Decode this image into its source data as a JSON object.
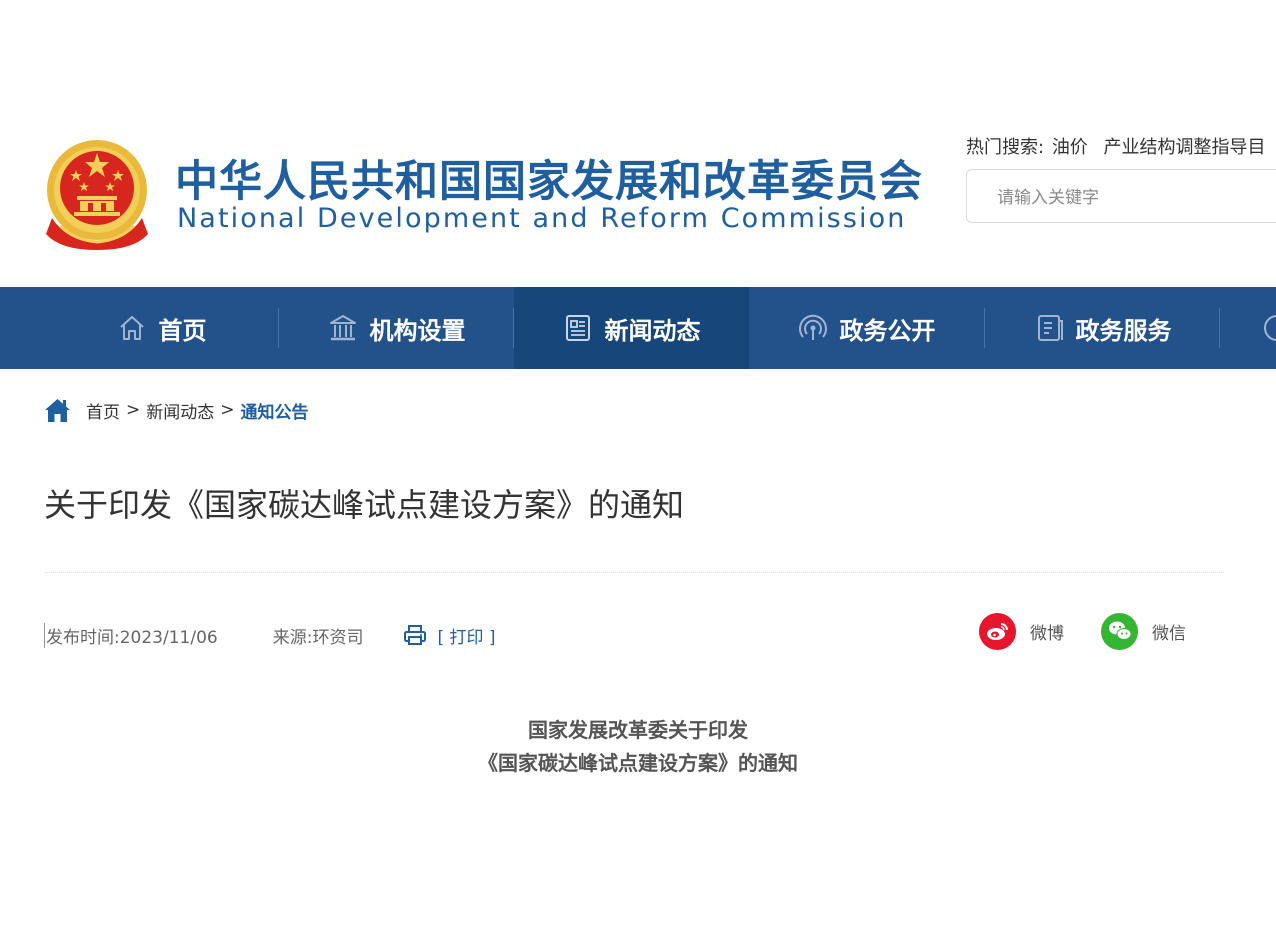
{
  "header": {
    "org_name_cn": "中华人民共和国国家发展和改革委员会",
    "org_name_en": "National Development and Reform Commission",
    "hot_search_label": "热门搜索:",
    "hot_search_links": [
      "油价",
      "产业结构调整指导目"
    ],
    "search_placeholder": "请输入关键字"
  },
  "nav": {
    "items": [
      {
        "label": "首页",
        "icon": "home-icon"
      },
      {
        "label": "机构设置",
        "icon": "institution-icon"
      },
      {
        "label": "新闻动态",
        "icon": "news-icon",
        "active": true
      },
      {
        "label": "政务公开",
        "icon": "broadcast-icon"
      },
      {
        "label": "政务服务",
        "icon": "document-icon"
      }
    ]
  },
  "breadcrumb": {
    "items": [
      "首页",
      "新闻动态",
      "通知公告"
    ],
    "separator": ">"
  },
  "article": {
    "title": "关于印发《国家碳达峰试点建设方案》的通知",
    "publish_label": "发布时间:",
    "publish_date": "2023/11/06",
    "source_label": "来源:",
    "source": "环资司",
    "print_label": "[ 打印 ]",
    "share": [
      {
        "label": "微博",
        "icon": "weibo-icon",
        "color": "#e6162d"
      },
      {
        "label": "微信",
        "icon": "wechat-icon",
        "color": "#35b534"
      }
    ],
    "doc_heading_line1": "国家发展改革委关于印发",
    "doc_heading_line2": "《国家碳达峰试点建设方案》的通知"
  },
  "colors": {
    "brand_blue": "#1f5fa0",
    "nav_bg": "#23528a",
    "nav_active_bg": "#17467a",
    "emblem_red": "#d7261e",
    "emblem_gold": "#f0c23b"
  }
}
